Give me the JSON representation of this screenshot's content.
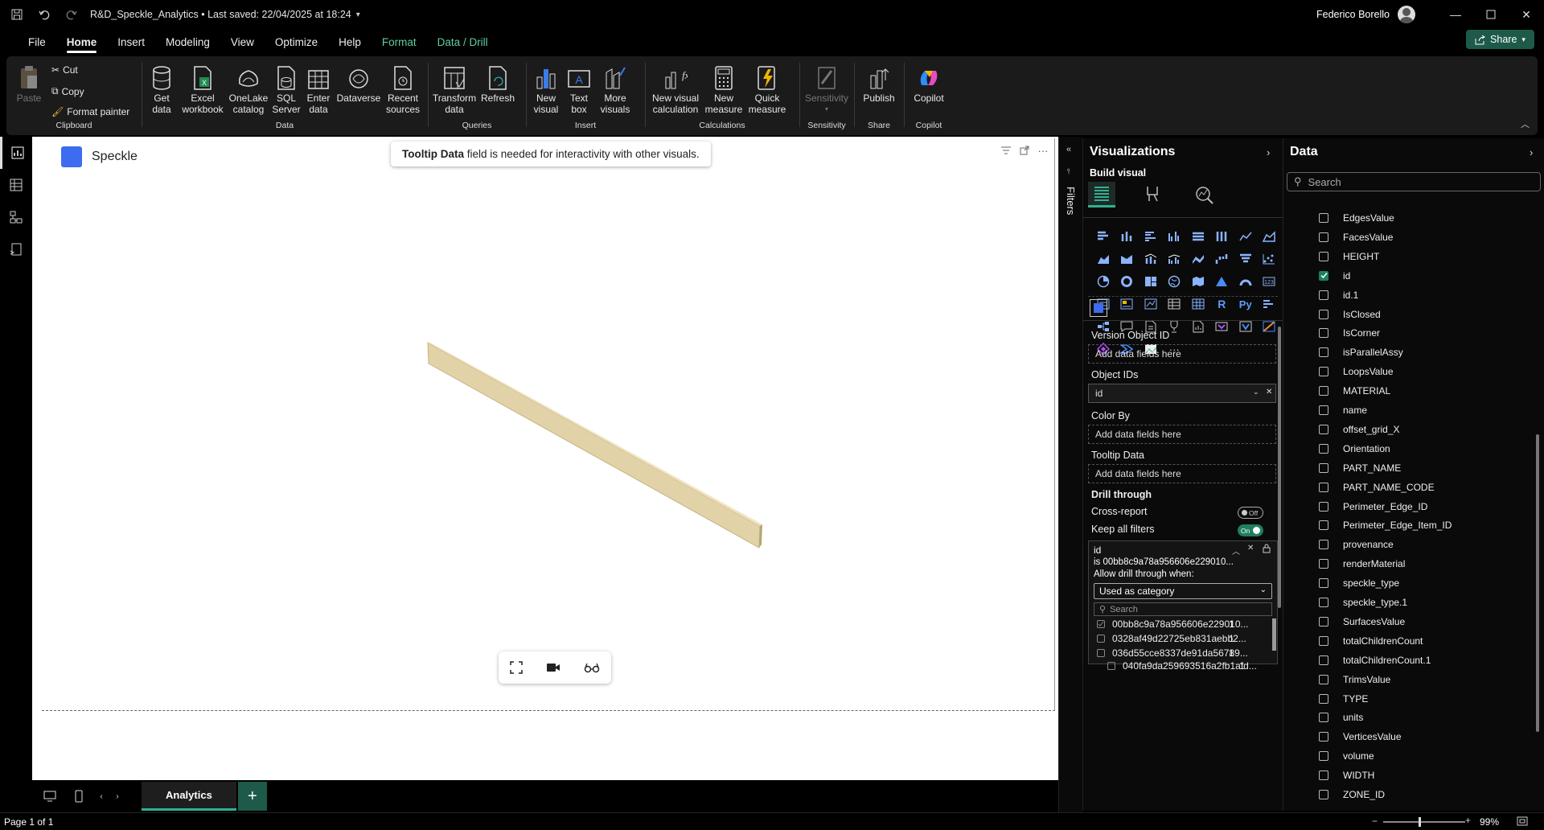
{
  "titlebar": {
    "file_title": "R&D_Speckle_Analytics • Last saved: 22/04/2025 at 18:24",
    "user_name": "Federico Borello"
  },
  "menu": {
    "items": [
      "File",
      "Home",
      "Insert",
      "Modeling",
      "View",
      "Optimize",
      "Help",
      "Format",
      "Data / Drill"
    ],
    "share_label": "Share"
  },
  "ribbon": {
    "clipboard": {
      "paste": "Paste",
      "cut": "Cut",
      "copy": "Copy",
      "format_painter": "Format painter",
      "label": "Clipboard"
    },
    "data": {
      "get_data": "Get\ndata",
      "excel": "Excel\nworkbook",
      "onelake": "OneLake\ncatalog",
      "sql": "SQL\nServer",
      "enter": "Enter\ndata",
      "dataverse": "Dataverse",
      "recent": "Recent\nsources",
      "label": "Data"
    },
    "queries": {
      "transform": "Transform\ndata",
      "refresh": "Refresh",
      "label": "Queries"
    },
    "insert": {
      "new_visual": "New\nvisual",
      "text_box": "Text\nbox",
      "more_visuals": "More\nvisuals",
      "label": "Insert"
    },
    "calculations": {
      "new_visual_calc": "New visual\ncalculation",
      "new_measure": "New\nmeasure",
      "quick_measure": "Quick\nmeasure",
      "label": "Calculations"
    },
    "sensitivity": {
      "sensitivity": "Sensitivity",
      "label": "Sensitivity"
    },
    "share": {
      "publish": "Publish",
      "label": "Share"
    },
    "copilot": {
      "copilot": "Copilot",
      "label": "Copilot"
    }
  },
  "canvas": {
    "visual_title": "Speckle",
    "tooltip_bold": "Tooltip Data",
    "tooltip_rest": " field is needed for interactivity with other visuals.",
    "beam_color": "#e2d2a8"
  },
  "pagebar": {
    "page_tab": "Analytics",
    "add_label": "+"
  },
  "status": {
    "page": "Page 1 of 1",
    "zoom": "99%"
  },
  "filters": {
    "label": "Filters"
  },
  "visualizations": {
    "title": "Visualizations",
    "build_visual": "Build visual",
    "wells": {
      "version_object_id": "Version Object ID",
      "object_ids": "Object IDs",
      "object_ids_value": "id",
      "color_by": "Color By",
      "tooltip_data": "Tooltip Data",
      "add_fields": "Add data fields here"
    },
    "drill": {
      "title": "Drill through",
      "cross_report": "Cross-report",
      "cross_report_state": "Off",
      "keep_filters": "Keep all filters",
      "keep_filters_state": "On"
    },
    "filter_card": {
      "field": "id",
      "condition": "is 00bb8c9a78a956606e229010...",
      "allow_label": "Allow drill through when:",
      "dropdown": "Used as category",
      "search_placeholder": "Search",
      "values": [
        {
          "id": "00bb8c9a78a956606e229010...",
          "count": "1",
          "checked": true
        },
        {
          "id": "0328af49d22725eb831aebb2...",
          "count": "1",
          "checked": false
        },
        {
          "id": "036d55cce8337de91da56789...",
          "count": "1",
          "checked": false
        },
        {
          "id": "040fa9da259693516a2fb1afd...",
          "count": "1",
          "checked": false
        }
      ]
    }
  },
  "data_pane": {
    "title": "Data",
    "search_placeholder": "Search",
    "fields": [
      {
        "name": "EdgesValue",
        "checked": false
      },
      {
        "name": "FacesValue",
        "checked": false
      },
      {
        "name": "HEIGHT",
        "checked": false
      },
      {
        "name": "id",
        "checked": true
      },
      {
        "name": "id.1",
        "checked": false
      },
      {
        "name": "IsClosed",
        "checked": false
      },
      {
        "name": "IsCorner",
        "checked": false
      },
      {
        "name": "isParallelAssy",
        "checked": false
      },
      {
        "name": "LoopsValue",
        "checked": false
      },
      {
        "name": "MATERIAL",
        "checked": false
      },
      {
        "name": "name",
        "checked": false
      },
      {
        "name": "offset_grid_X",
        "checked": false
      },
      {
        "name": "Orientation",
        "checked": false
      },
      {
        "name": "PART_NAME",
        "checked": false
      },
      {
        "name": "PART_NAME_CODE",
        "checked": false
      },
      {
        "name": "Perimeter_Edge_ID",
        "checked": false
      },
      {
        "name": "Perimeter_Edge_Item_ID",
        "checked": false
      },
      {
        "name": "provenance",
        "checked": false
      },
      {
        "name": "renderMaterial",
        "checked": false
      },
      {
        "name": "speckle_type",
        "checked": false
      },
      {
        "name": "speckle_type.1",
        "checked": false
      },
      {
        "name": "SurfacesValue",
        "checked": false
      },
      {
        "name": "totalChildrenCount",
        "checked": false
      },
      {
        "name": "totalChildrenCount.1",
        "checked": false
      },
      {
        "name": "TrimsValue",
        "checked": false
      },
      {
        "name": "TYPE",
        "checked": false
      },
      {
        "name": "units",
        "checked": false
      },
      {
        "name": "VerticesValue",
        "checked": false
      },
      {
        "name": "volume",
        "checked": false
      },
      {
        "name": "WIDTH",
        "checked": false
      },
      {
        "name": "ZONE_ID",
        "checked": false
      }
    ]
  },
  "colors": {
    "accent_green": "#2fb193",
    "speckle_blue": "#3d6cf0"
  }
}
